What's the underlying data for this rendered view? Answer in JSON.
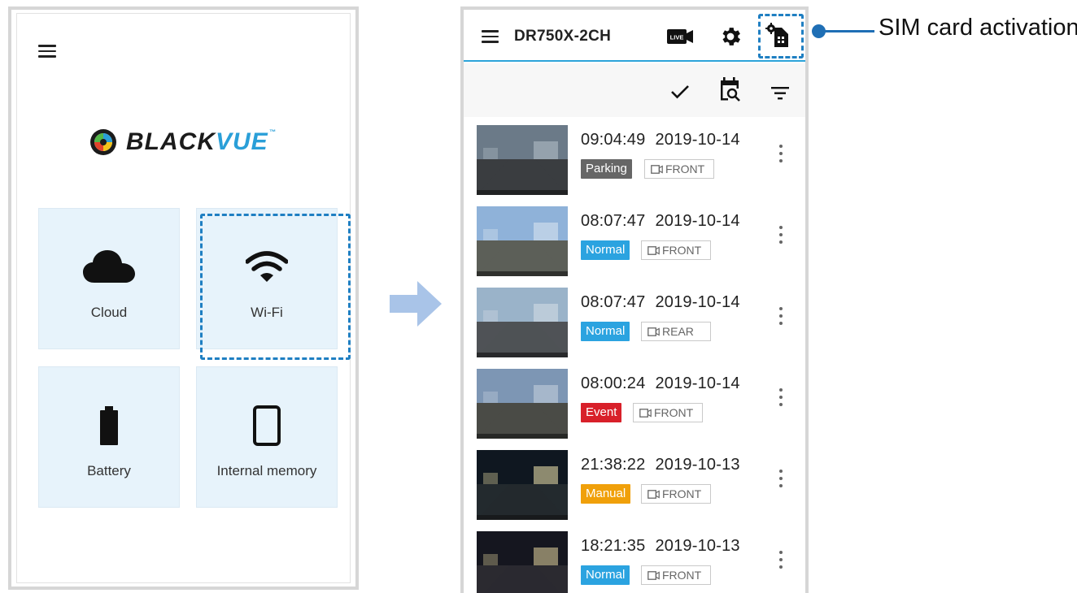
{
  "left_screen": {
    "logo": {
      "text_black": "BLACK",
      "text_blue": "VUE",
      "tm": "™"
    },
    "tiles": [
      {
        "id": "cloud",
        "label": "Cloud",
        "icon": "cloud-icon"
      },
      {
        "id": "wifi",
        "label": "Wi-Fi",
        "icon": "wifi-icon",
        "highlighted": true
      },
      {
        "id": "battery",
        "label": "Battery",
        "icon": "battery-icon"
      },
      {
        "id": "memory",
        "label": "Internal memory",
        "icon": "phone-memory-icon"
      }
    ]
  },
  "right_screen": {
    "device_name": "DR750X-2CH",
    "live_label": "LIVE",
    "toolbar_icons": [
      "check-icon",
      "calendar-search-icon",
      "filter-icon"
    ],
    "records": [
      {
        "time": "09:04:49",
        "date": "2019-10-14",
        "type": "Parking",
        "type_color": "#666666",
        "camera": "FRONT"
      },
      {
        "time": "08:07:47",
        "date": "2019-10-14",
        "type": "Normal",
        "type_color": "#2ba3e0",
        "camera": "FRONT"
      },
      {
        "time": "08:07:47",
        "date": "2019-10-14",
        "type": "Normal",
        "type_color": "#2ba3e0",
        "camera": "REAR"
      },
      {
        "time": "08:00:24",
        "date": "2019-10-14",
        "type": "Event",
        "type_color": "#d8202a",
        "camera": "FRONT"
      },
      {
        "time": "21:38:22",
        "date": "2019-10-13",
        "type": "Manual",
        "type_color": "#f0a00a",
        "camera": "FRONT"
      },
      {
        "time": "18:21:35",
        "date": "2019-10-13",
        "type": "Normal",
        "type_color": "#2ba3e0",
        "camera": "FRONT"
      }
    ]
  },
  "callout": {
    "label": "SIM card activation"
  },
  "colors": {
    "accent": "#2ba3d9",
    "highlight": "#1f7fc2",
    "arrow": "#a9c4e8"
  }
}
